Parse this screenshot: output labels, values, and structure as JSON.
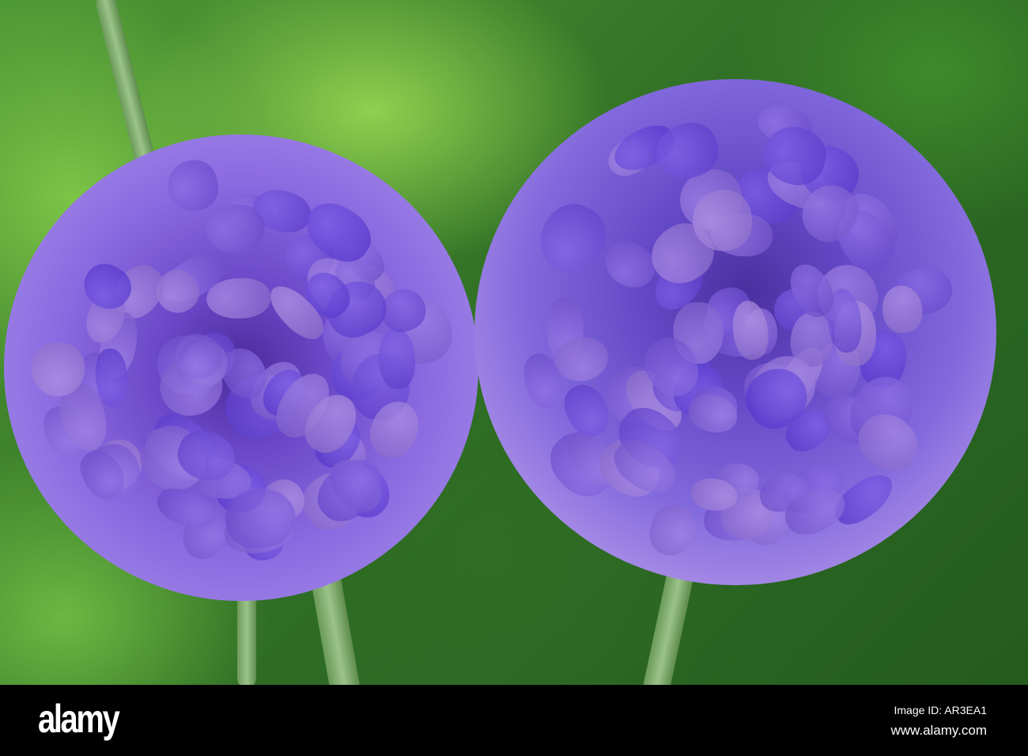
{
  "photo": {
    "subject": "two purple devil's-bit scabious flower heads on green background"
  },
  "watermark": {
    "logo": "alamy",
    "image_id": "Image ID: AR3EA1",
    "url": "www.alamy.com"
  },
  "colors": {
    "flower": "#7a5fd8",
    "background": "#3f8a2e",
    "bar": "#000000"
  }
}
